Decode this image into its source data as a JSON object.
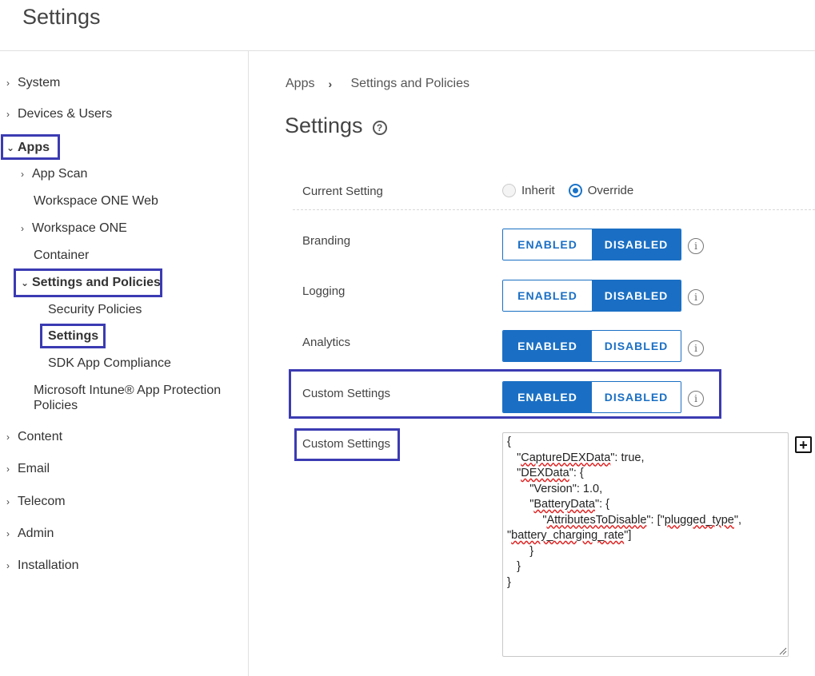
{
  "header": {
    "title": "Settings"
  },
  "sidebar": {
    "items": [
      {
        "label": "System",
        "chevron": "right"
      },
      {
        "label": "Devices & Users",
        "chevron": "right"
      },
      {
        "label": "Apps",
        "chevron": "down"
      },
      {
        "label": "App Scan",
        "chevron": "right"
      },
      {
        "label": "Workspace ONE Web",
        "chevron": ""
      },
      {
        "label": "Workspace ONE",
        "chevron": "right"
      },
      {
        "label": "Container",
        "chevron": ""
      },
      {
        "label": "Settings and Policies",
        "chevron": "down"
      },
      {
        "label": "Security Policies",
        "chevron": ""
      },
      {
        "label": "Settings",
        "chevron": ""
      },
      {
        "label": "SDK App Compliance",
        "chevron": ""
      },
      {
        "label": "Microsoft Intune® App Protection Policies",
        "chevron": ""
      },
      {
        "label": "Content",
        "chevron": "right"
      },
      {
        "label": "Email",
        "chevron": "right"
      },
      {
        "label": "Telecom",
        "chevron": "right"
      },
      {
        "label": "Admin",
        "chevron": "right"
      },
      {
        "label": "Installation",
        "chevron": "right"
      }
    ]
  },
  "breadcrumb": {
    "root": "Apps",
    "separator": "›",
    "current": "Settings and Policies"
  },
  "page": {
    "title": "Settings",
    "help_glyph": "?"
  },
  "current_setting": {
    "label": "Current Setting",
    "options": [
      {
        "label": "Inherit",
        "checked": false
      },
      {
        "label": "Override",
        "checked": true
      }
    ]
  },
  "toggles": {
    "enabled_label": "ENABLED",
    "disabled_label": "DISABLED",
    "info_glyph": "i",
    "rows": [
      {
        "label": "Branding",
        "state": "disabled"
      },
      {
        "label": "Logging",
        "state": "disabled"
      },
      {
        "label": "Analytics",
        "state": "enabled"
      },
      {
        "label": "Custom Settings",
        "state": "enabled"
      }
    ]
  },
  "custom_settings": {
    "label": "Custom Settings",
    "lines": [
      "{",
      "   \"CaptureDEXData\": true,",
      "   \"DEXData\": {",
      "       \"Version\": 1.0,",
      "       \"BatteryData\": {",
      "           \"AttributesToDisable\": [\"plugged_type\",",
      "\"battery_charging_rate\"]",
      "       }",
      "   }",
      "}"
    ],
    "add_glyph": "+"
  },
  "colors": {
    "accent": "#1a6fc4",
    "highlight": "#3b3bb3"
  },
  "icons": [
    "chevron-right-icon",
    "chevron-down-icon",
    "help-icon",
    "info-icon",
    "add-icon",
    "resize-handle-icon"
  ]
}
